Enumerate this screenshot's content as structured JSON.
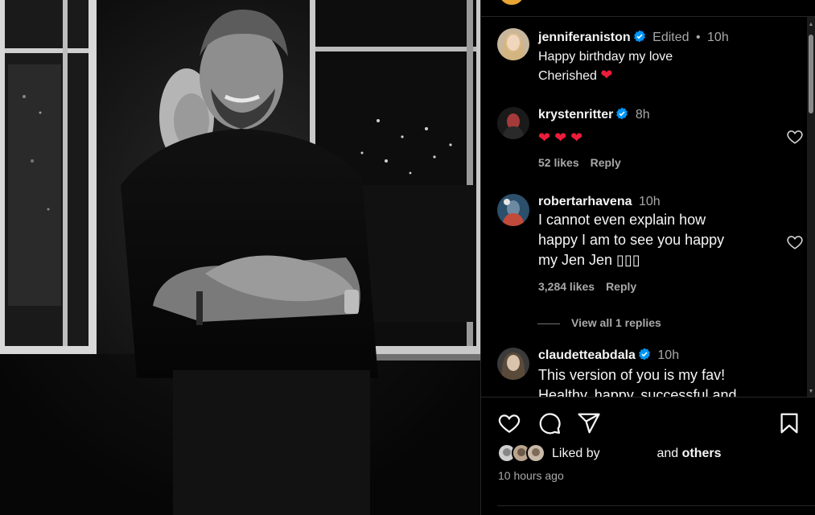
{
  "post": {
    "author_username": "jenniferaniston",
    "author_meta_edited": "Edited",
    "author_meta_separator": "•",
    "author_meta_time": "10h",
    "caption_line1": "Happy birthday my love",
    "caption_line2": "Cherished",
    "caption_emoji": "❤"
  },
  "comments": [
    {
      "username": "krystenritter",
      "time": "8h",
      "text": "❤ ❤ ❤",
      "likes": "52 likes",
      "reply": "Reply"
    },
    {
      "username": "robertarhavena",
      "time": "10h",
      "text_line1": "I cannot even explain how",
      "text_line2": "happy I am to see you happy",
      "text_line3": "my Jen Jen ▯▯▯",
      "likes": "3,284 likes",
      "reply": "Reply",
      "view_replies": "View all 1 replies"
    },
    {
      "username": "claudetteabdala",
      "time": "10h",
      "text_line1": "This version of you is my fav!",
      "text_line2": "Healthy, happy, successful and"
    }
  ],
  "footer": {
    "liked_by": "Liked by",
    "and": "and",
    "others": "others",
    "timestamp": "10 hours ago"
  },
  "icons": {
    "like": "heart-icon",
    "comment": "comment-icon",
    "share": "share-icon",
    "save": "bookmark-icon",
    "verified": "verified-badge-icon"
  },
  "colors": {
    "background": "#000000",
    "verified": "#0095f6",
    "heart": "#ed1c3a",
    "secondary_text": "#a8a8a8"
  }
}
